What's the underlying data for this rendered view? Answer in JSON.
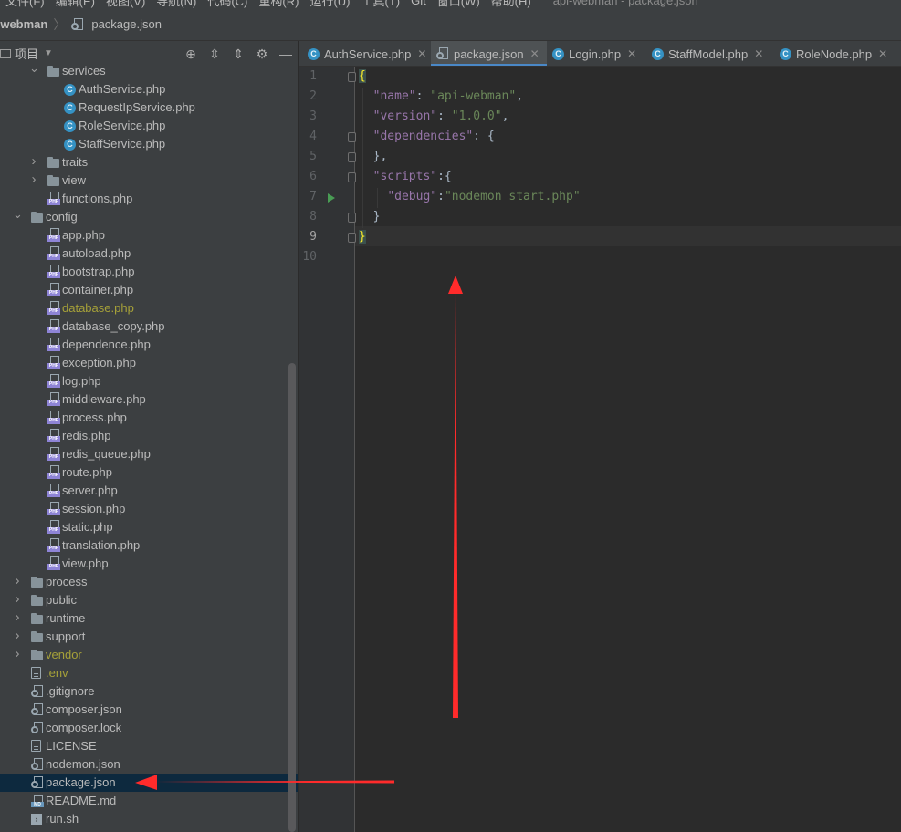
{
  "menubar": {
    "items": [
      "文件(F)",
      "编辑(E)",
      "视图(V)",
      "导航(N)",
      "代码(C)",
      "重构(R)",
      "运行(U)",
      "工具(T)",
      "Git",
      "窗口(W)",
      "帮助(H)"
    ],
    "window_title": "api-webman - package.json"
  },
  "navbar": {
    "project": "-webman",
    "file": "package.json"
  },
  "project_panel": {
    "title": "项目",
    "tools": [
      "target-icon",
      "expand-all-icon",
      "collapse-all-icon",
      "gear-icon",
      "minimize-icon"
    ]
  },
  "tree": [
    {
      "label": "services",
      "type": "folder",
      "expanded": true,
      "depth": 2
    },
    {
      "label": "AuthService.php",
      "type": "class",
      "depth": 3
    },
    {
      "label": "RequestIpService.php",
      "type": "class",
      "depth": 3
    },
    {
      "label": "RoleService.php",
      "type": "class",
      "depth": 3
    },
    {
      "label": "StaffService.php",
      "type": "class",
      "depth": 3
    },
    {
      "label": "traits",
      "type": "folder",
      "expanded": false,
      "depth": 2
    },
    {
      "label": "view",
      "type": "folder",
      "expanded": false,
      "depth": 2
    },
    {
      "label": "functions.php",
      "type": "php",
      "depth": 2
    },
    {
      "label": "config",
      "type": "folder",
      "expanded": true,
      "depth": 1
    },
    {
      "label": "app.php",
      "type": "php",
      "depth": 2
    },
    {
      "label": "autoload.php",
      "type": "php",
      "depth": 2
    },
    {
      "label": "bootstrap.php",
      "type": "php",
      "depth": 2
    },
    {
      "label": "container.php",
      "type": "php",
      "depth": 2
    },
    {
      "label": "database.php",
      "type": "php",
      "depth": 2,
      "status": "warn"
    },
    {
      "label": "database_copy.php",
      "type": "php",
      "depth": 2
    },
    {
      "label": "dependence.php",
      "type": "php",
      "depth": 2
    },
    {
      "label": "exception.php",
      "type": "php",
      "depth": 2
    },
    {
      "label": "log.php",
      "type": "php",
      "depth": 2
    },
    {
      "label": "middleware.php",
      "type": "php",
      "depth": 2
    },
    {
      "label": "process.php",
      "type": "php",
      "depth": 2
    },
    {
      "label": "redis.php",
      "type": "php",
      "depth": 2
    },
    {
      "label": "redis_queue.php",
      "type": "php",
      "depth": 2
    },
    {
      "label": "route.php",
      "type": "php",
      "depth": 2
    },
    {
      "label": "server.php",
      "type": "php",
      "depth": 2
    },
    {
      "label": "session.php",
      "type": "php",
      "depth": 2
    },
    {
      "label": "static.php",
      "type": "php",
      "depth": 2
    },
    {
      "label": "translation.php",
      "type": "php",
      "depth": 2
    },
    {
      "label": "view.php",
      "type": "php",
      "depth": 2
    },
    {
      "label": "process",
      "type": "folder",
      "expanded": false,
      "depth": 1
    },
    {
      "label": "public",
      "type": "folder",
      "expanded": false,
      "depth": 1
    },
    {
      "label": "runtime",
      "type": "folder",
      "expanded": false,
      "depth": 1
    },
    {
      "label": "support",
      "type": "folder",
      "expanded": false,
      "depth": 1
    },
    {
      "label": "vendor",
      "type": "folder",
      "expanded": false,
      "depth": 1,
      "status": "excl"
    },
    {
      "label": ".env",
      "type": "text",
      "depth": 1,
      "status": "ignored"
    },
    {
      "label": ".gitignore",
      "type": "json",
      "depth": 1
    },
    {
      "label": "composer.json",
      "type": "json",
      "depth": 1
    },
    {
      "label": "composer.lock",
      "type": "json",
      "depth": 1
    },
    {
      "label": "LICENSE",
      "type": "text",
      "depth": 1
    },
    {
      "label": "nodemon.json",
      "type": "json",
      "depth": 1
    },
    {
      "label": "package.json",
      "type": "json",
      "depth": 1,
      "selected": true
    },
    {
      "label": "README.md",
      "type": "md",
      "depth": 1
    },
    {
      "label": "run.sh",
      "type": "sh",
      "depth": 1
    }
  ],
  "tabs": [
    {
      "label": "AuthService.php",
      "icon": "class-icon",
      "active": false
    },
    {
      "label": "package.json",
      "icon": "json-icon",
      "active": true
    },
    {
      "label": "Login.php",
      "icon": "class-icon",
      "active": false
    },
    {
      "label": "StaffModel.php",
      "icon": "class-icon",
      "active": false
    },
    {
      "label": "RoleNode.php",
      "icon": "class-icon",
      "active": false
    }
  ],
  "editor": {
    "line_numbers": [
      "1",
      "2",
      "3",
      "4",
      "5",
      "6",
      "7",
      "8",
      "9",
      "10"
    ],
    "current_line": 9,
    "lines": [
      [
        {
          "t": "{",
          "c": "brace-hl"
        }
      ],
      [
        {
          "t": "  "
        },
        {
          "t": "\"name\"",
          "c": "k"
        },
        {
          "t": ": "
        },
        {
          "t": "\"api-webman\"",
          "c": "s"
        },
        {
          "t": ","
        }
      ],
      [
        {
          "t": "  "
        },
        {
          "t": "\"version\"",
          "c": "k"
        },
        {
          "t": ": "
        },
        {
          "t": "\"1.0.0\"",
          "c": "s"
        },
        {
          "t": ","
        }
      ],
      [
        {
          "t": "  "
        },
        {
          "t": "\"dependencies\"",
          "c": "k"
        },
        {
          "t": ": {"
        }
      ],
      [
        {
          "t": "  },"
        }
      ],
      [
        {
          "t": "  "
        },
        {
          "t": "\"scripts\"",
          "c": "k"
        },
        {
          "t": ":{"
        }
      ],
      [
        {
          "t": "    "
        },
        {
          "t": "\"debug\"",
          "c": "k"
        },
        {
          "t": ":"
        },
        {
          "t": "\"nodemon start.php\"",
          "c": "s"
        }
      ],
      [
        {
          "t": "  }"
        }
      ],
      [
        {
          "t": "}",
          "c": "brace-hl"
        }
      ],
      []
    ]
  },
  "colors": {
    "annotation_arrow": "#ff2b2b",
    "selection": "#0d293e",
    "accent": "#4a88c7"
  }
}
